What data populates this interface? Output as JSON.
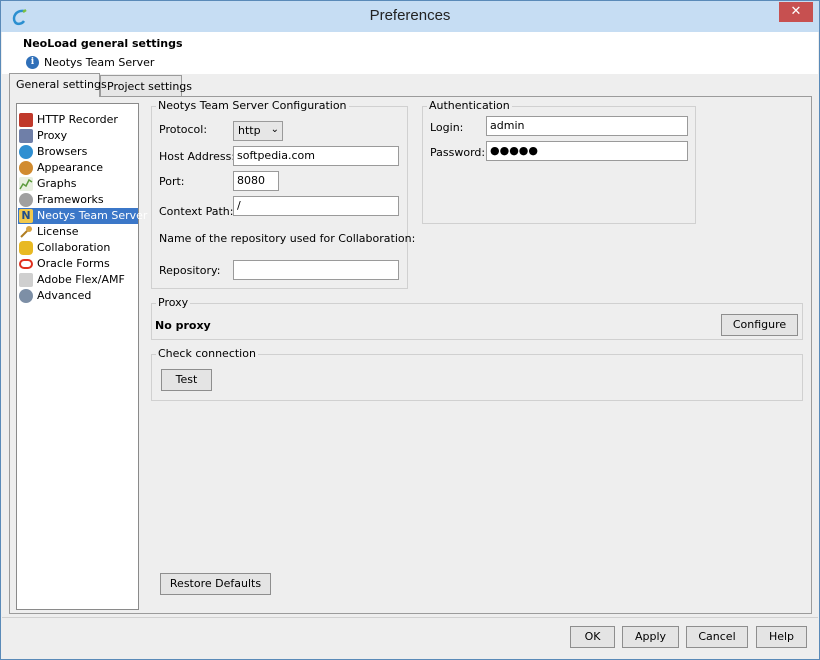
{
  "window": {
    "title": "Preferences",
    "close_glyph": "✕"
  },
  "header": {
    "title": "NeoLoad general settings",
    "subtitle": "Neotys Team Server",
    "info_glyph": "i"
  },
  "tabs": [
    {
      "label": "General settings",
      "active": true
    },
    {
      "label": "Project settings",
      "active": false
    }
  ],
  "sidebar": {
    "items": [
      {
        "label": "HTTP Recorder",
        "icon": "http-recorder-icon",
        "color": "#c0392b"
      },
      {
        "label": "Proxy",
        "icon": "proxy-icon",
        "color": "#6f7fa8"
      },
      {
        "label": "Browsers",
        "icon": "globe-icon",
        "color": "#2f8fd1"
      },
      {
        "label": "Appearance",
        "icon": "palette-icon",
        "color": "#d18b2f"
      },
      {
        "label": "Graphs",
        "icon": "graph-icon",
        "color": "#5c9b3d"
      },
      {
        "label": "Frameworks",
        "icon": "frameworks-icon",
        "color": "#a0a0a0"
      },
      {
        "label": "Neotys Team Server",
        "icon": "neotys-icon",
        "color": "#f2c94c",
        "selected": true
      },
      {
        "label": "License",
        "icon": "key-icon",
        "color": "#d9a441"
      },
      {
        "label": "Collaboration",
        "icon": "database-icon",
        "color": "#e8b923"
      },
      {
        "label": "Oracle Forms",
        "icon": "oracle-icon",
        "color": "#e0301e"
      },
      {
        "label": "Adobe Flex/AMF",
        "icon": "flex-icon",
        "color": "#9a9a9a"
      },
      {
        "label": "Advanced",
        "icon": "gears-icon",
        "color": "#7d8fa6"
      }
    ]
  },
  "nts": {
    "group_title": "Neotys Team Server Configuration",
    "protocol_label": "Protocol:",
    "protocol_value": "http",
    "host_label": "Host Address:",
    "host_value": "softpedia.com",
    "port_label": "Port:",
    "port_value": "8080",
    "context_label": "Context Path:",
    "context_value": "/",
    "repo_note": "Name of the repository used for Collaboration:",
    "repo_label": "Repository:",
    "repo_value": ""
  },
  "auth": {
    "group_title": "Authentication",
    "login_label": "Login:",
    "login_value": "admin",
    "password_label": "Password:",
    "password_value": "●●●●●"
  },
  "proxy": {
    "group_title": "Proxy",
    "status": "No proxy",
    "configure_label": "Configure"
  },
  "check": {
    "group_title": "Check connection",
    "test_label": "Test"
  },
  "restore_label": "Restore Defaults",
  "footer": {
    "ok_label": "OK",
    "apply_label": "Apply",
    "cancel_label": "Cancel",
    "help_label": "Help"
  }
}
